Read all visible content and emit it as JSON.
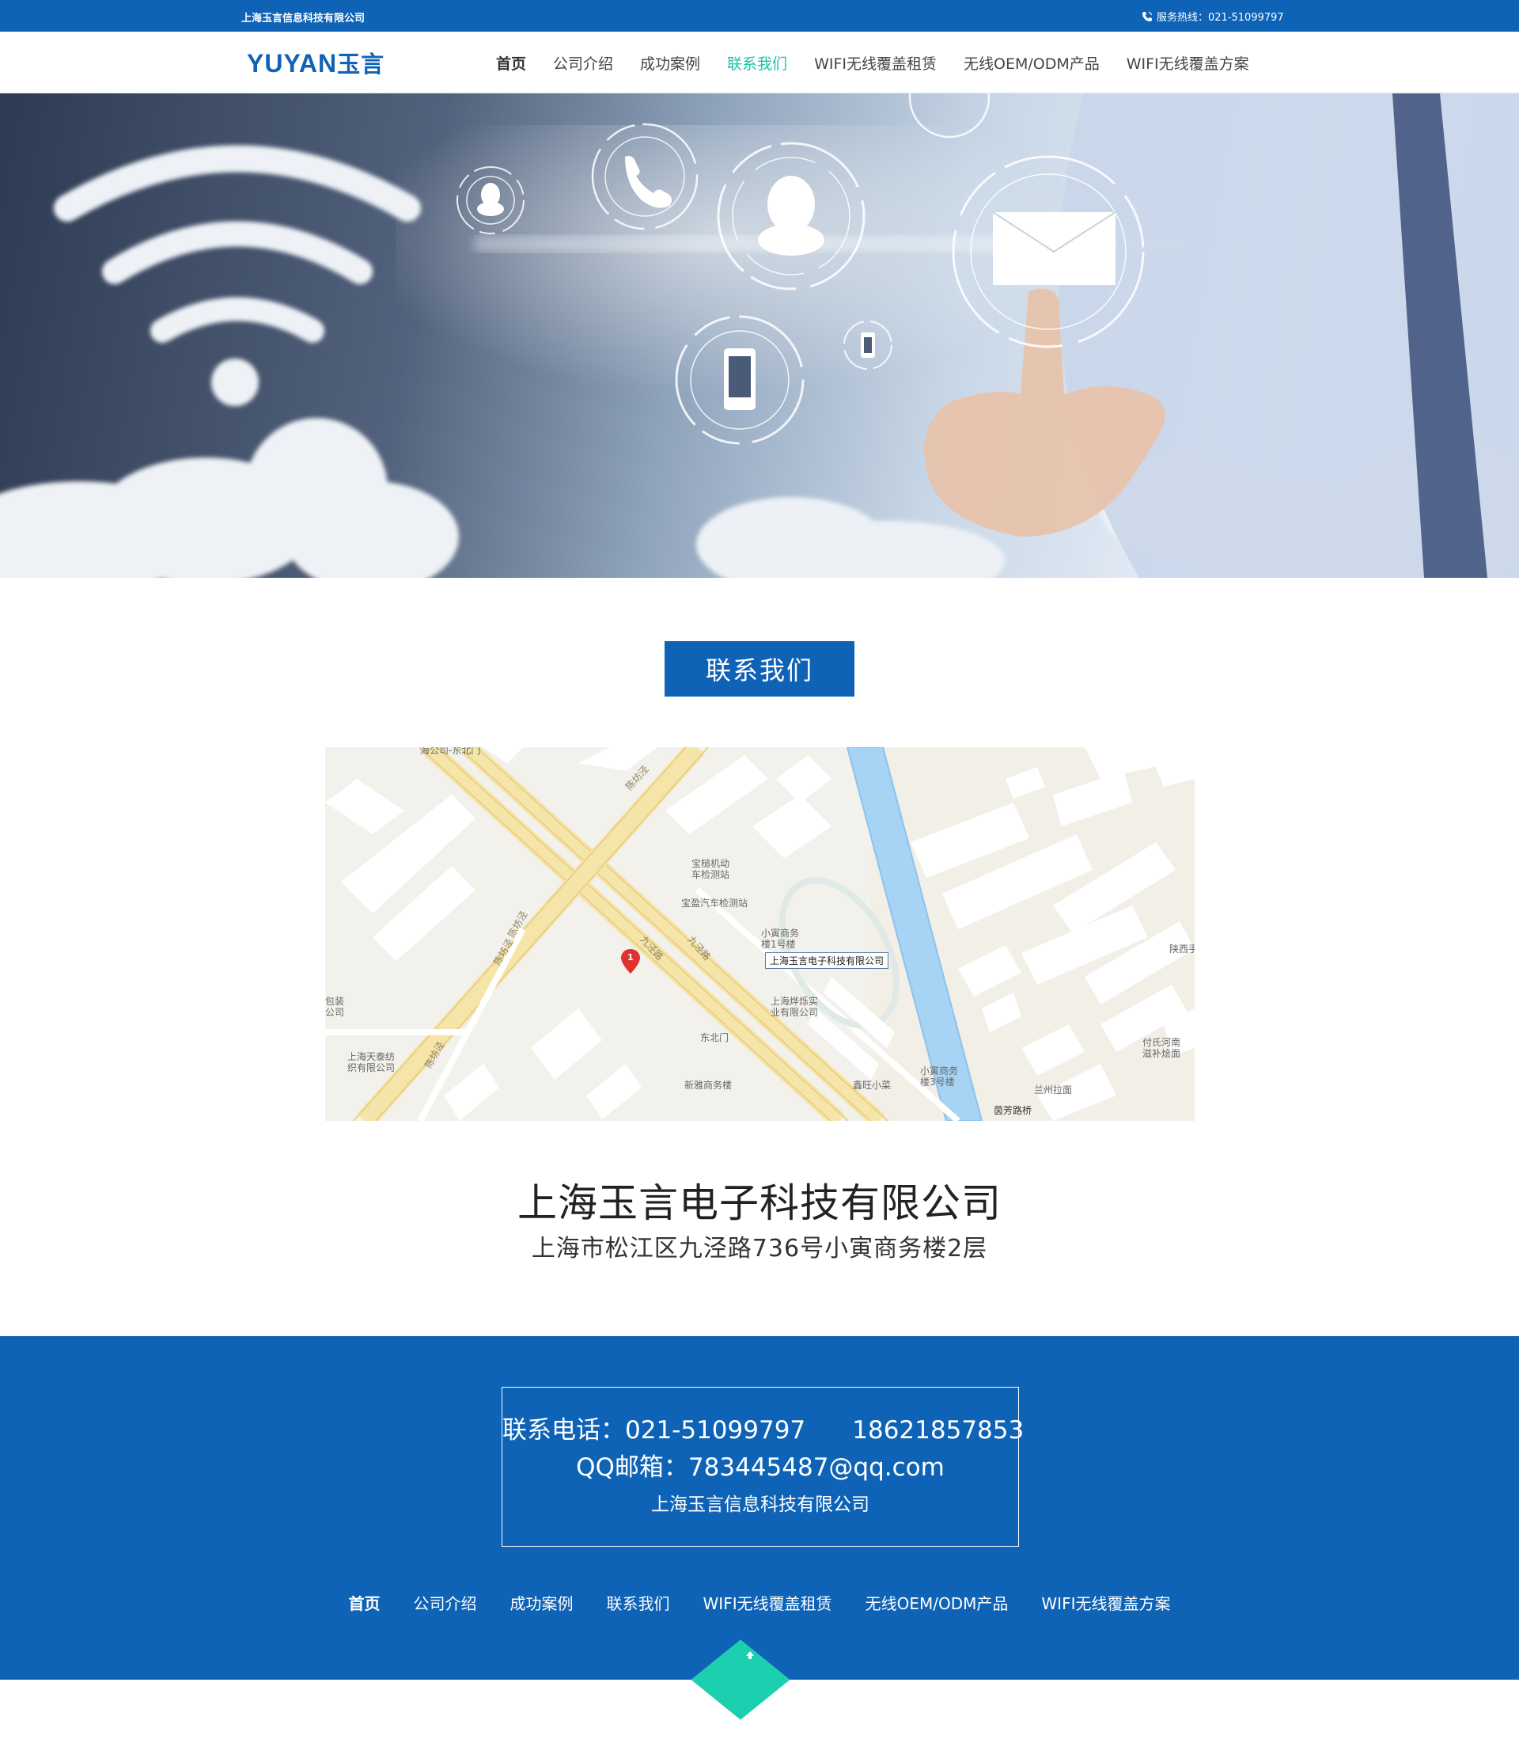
{
  "topbar": {
    "company": "上海玉言信息科技有限公司",
    "hotline": "服务热线：021-51099797"
  },
  "header": {
    "logo_latin": "YUYAN",
    "logo_cn": "玉言"
  },
  "nav": [
    {
      "label": "首页"
    },
    {
      "label": "公司介绍"
    },
    {
      "label": "成功案例"
    },
    {
      "label": "联系我们"
    },
    {
      "label": "WIFI无线覆盖租赁"
    },
    {
      "label": "无线OEM/ODM产品"
    },
    {
      "label": "WIFI无线覆盖方案"
    }
  ],
  "section": {
    "title": "联系我们"
  },
  "map": {
    "pin_number": "1",
    "pin_label": "上海玉言电子科技有限公司",
    "pois": [
      "宝槌机动\n车检测站",
      "宝盈汽车检测站",
      "小寅商务\n楼1号楼",
      "上海烨烁实\n业有限公司",
      "东北门",
      "新雅商务楼",
      "鑫旺小菜",
      "小寅商务\n楼3号楼",
      "兰州拉面",
      "茵芳路桥",
      "付氏河南\n滋补烩面",
      "陕西手",
      "包装\n公司",
      "上海天泰纺\n织有限公司",
      "海公司-东北门"
    ],
    "roads": [
      "九泾路",
      "九泾路",
      "陈坊泾",
      "陈坊泾",
      "陈坊泾",
      "陈坊泾"
    ]
  },
  "company": {
    "name": "上海玉言电子科技有限公司",
    "address": "上海市松江区九泾路736号小寅商务楼2层"
  },
  "footer": {
    "phone_line": "联系电话：021-51099797      18621857853",
    "email_line": "QQ邮箱：783445487@qq.com",
    "company_line": "上海玉言信息科技有限公司",
    "nav": [
      {
        "label": "首页"
      },
      {
        "label": "公司介绍"
      },
      {
        "label": "成功案例"
      },
      {
        "label": "联系我们"
      },
      {
        "label": "WIFI无线覆盖租赁"
      },
      {
        "label": "无线OEM/ODM产品"
      },
      {
        "label": "WIFI无线覆盖方案"
      }
    ],
    "to_top_icon": "arrow-up-icon"
  },
  "colors": {
    "brand_blue": "#0e63b6",
    "accent_teal": "#1cc2a5"
  }
}
